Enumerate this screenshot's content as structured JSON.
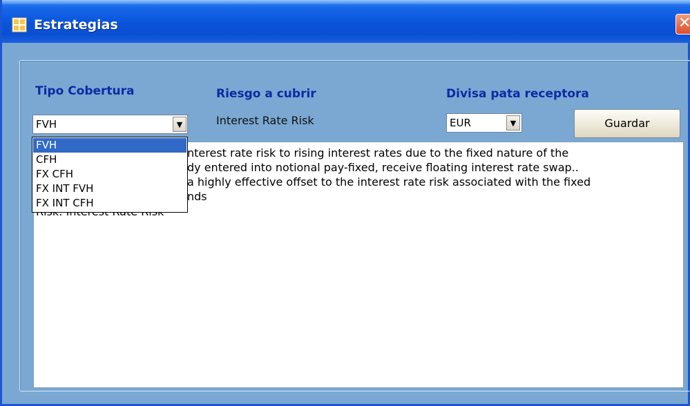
{
  "window": {
    "title": "Estrategias",
    "close_glyph": "✕"
  },
  "labels": {
    "tipo_cobertura": "Tipo Cobertura",
    "riesgo_cubrir": "Riesgo a cubrir",
    "divisa": "Divisa pata receptora"
  },
  "riesgo_value": "Interest Rate Risk",
  "tipo_combo": {
    "selected": "FVH",
    "options": [
      "FVH",
      "CFH",
      "FX CFH",
      "FX INT FVH",
      "FX INT CFH"
    ]
  },
  "divisa_combo": {
    "selected": "EUR"
  },
  "guardar_label": "Guardar",
  "description_lines": [
    "nterest rate risk to rising interest rates due to the fixed nature of the",
    "dy entered into notional pay-fixed, receive floating interest rate swap..",
    "a highly effective offset to the interest rate risk associated with the fixed",
    "nds",
    "Risk: Interest Rate Risk"
  ],
  "colors": {
    "titlebar": "#0a54da",
    "client_bg": "#7aa8d2",
    "label_blue": "#0c2aa6",
    "selection": "#3169c6"
  },
  "icons": {
    "app": "app-window-icon",
    "combo_arrow": "chevron-down-icon",
    "close": "close-icon"
  }
}
